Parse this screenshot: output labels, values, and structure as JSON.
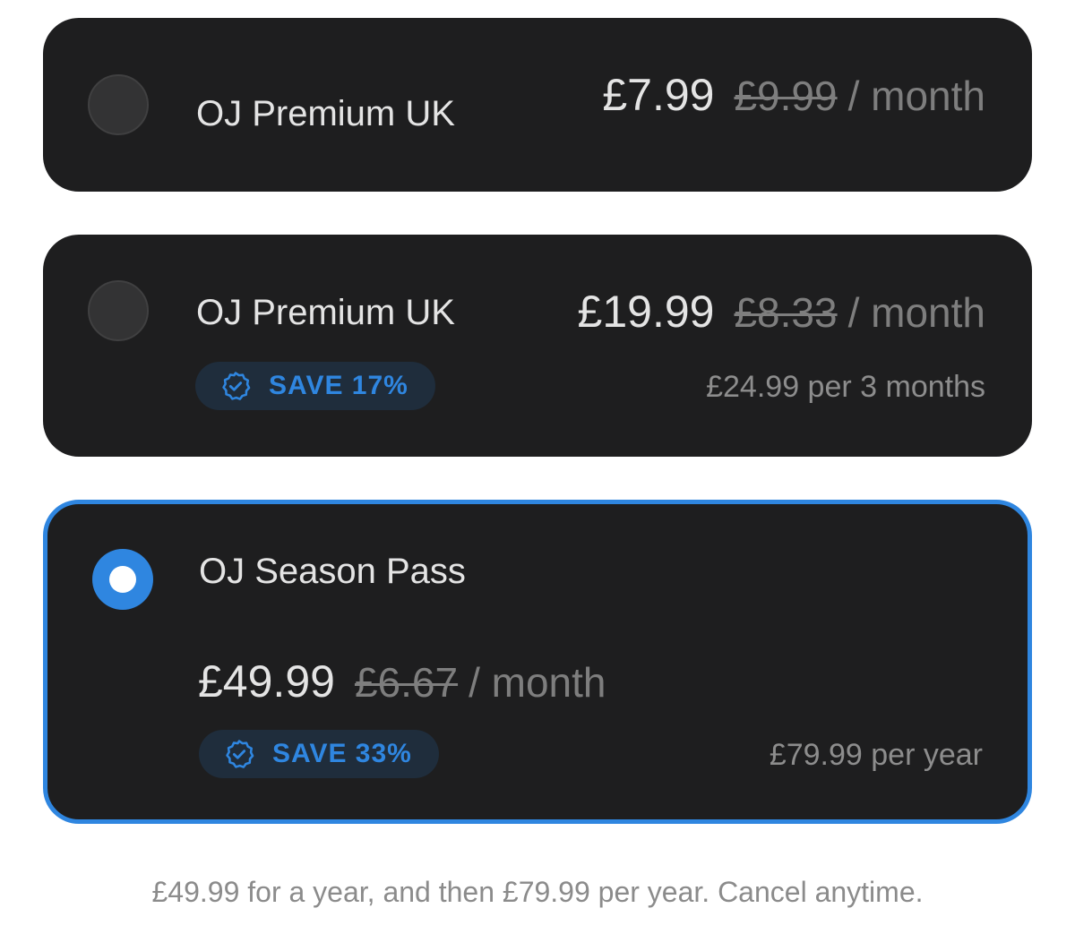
{
  "plans": [
    {
      "name": "OJ Premium UK",
      "price": "£7.99",
      "old_price": "£9.99",
      "period": "/ month",
      "selected": false
    },
    {
      "name": "OJ Premium UK",
      "price": "£19.99",
      "old_price": "£8.33",
      "period": "/ month",
      "badge": "SAVE 17%",
      "billing": "£24.99 per 3 months",
      "selected": false
    },
    {
      "name": "OJ Season Pass",
      "price": "£49.99",
      "old_price": "£6.67",
      "period": "/ month",
      "badge": "SAVE 33%",
      "billing": "£79.99 per year",
      "selected": true
    }
  ],
  "footer": "£49.99 for a year, and then £79.99 per year. Cancel anytime.",
  "colors": {
    "card_bg": "#1e1e1f",
    "accent": "#2f86e0",
    "badge_bg": "#1f2d3c",
    "text_primary": "#e4e4e4",
    "text_muted": "#7e7e7e"
  },
  "icons": {
    "badge": "verified-check-badge-icon"
  }
}
